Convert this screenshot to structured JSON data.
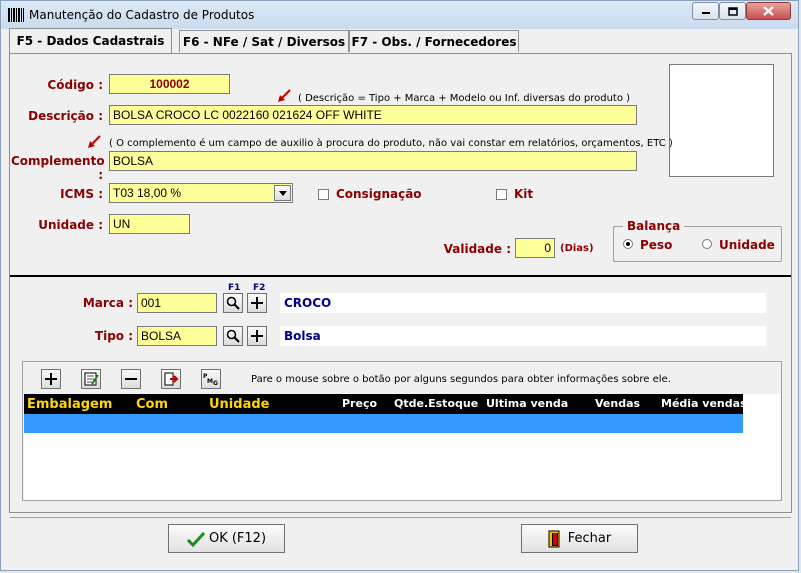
{
  "window": {
    "title": "Manutenção do Cadastro de Produtos"
  },
  "tabs": [
    {
      "label": "F5 - Dados Cadastrais",
      "active": true
    },
    {
      "label": "F6 - NFe / Sat / Diversos",
      "active": false
    },
    {
      "label": "F7 - Obs. / Fornecedores",
      "active": false
    }
  ],
  "form": {
    "codigo_label": "Código :",
    "codigo_value": "100002",
    "descricao_label": "Descrição :",
    "descricao_value": "BOLSA CROCO LC 0022160 021624 OFF WHITE",
    "descricao_note": "( Descrição = Tipo + Marca + Modelo ou Inf. diversas do produto )",
    "complemento_note": "( O complemento é um campo de auxilio à procura do produto, não vai constar em relatórios, orçamentos, ETC )",
    "complemento_label": "Complemento :",
    "complemento_value": "BOLSA",
    "icms_label": "ICMS :",
    "icms_value": "T03   18,00 %",
    "consignacao_label": "Consignação",
    "kit_label": "Kit",
    "unidade_label": "Unidade :",
    "unidade_value": "UN",
    "validade_label": "Validade :",
    "validade_value": "0",
    "validade_unit": "(Dias)",
    "balanca": {
      "title": "Balança",
      "peso_label": "Peso",
      "unidade_label": "Unidade",
      "selected": "Peso"
    }
  },
  "classification": {
    "f1_label": "F1",
    "f2_label": "F2",
    "marca_label": "Marca :",
    "marca_code": "001",
    "marca_desc": "CROCO",
    "tipo_label": "Tipo :",
    "tipo_code": "BOLSA",
    "tipo_desc": "Bolsa"
  },
  "toolbar": {
    "hint": "Pare o mouse sobre o botão por alguns segundos para obter informações sobre ele."
  },
  "grid": {
    "columns": [
      "Embalagem",
      "Com",
      "Unidade",
      "Preço",
      "Qtde.Estoque",
      "Ultima venda",
      "Vendas",
      "Média vendas"
    ],
    "rows": []
  },
  "buttons": {
    "ok_label": "OK  (F12)",
    "fechar_label": "Fechar"
  },
  "colors": {
    "field_yellow": "#ffff99",
    "label_red": "#8b0000",
    "desc_blue": "#00008b",
    "selection_blue": "#3399ff"
  }
}
